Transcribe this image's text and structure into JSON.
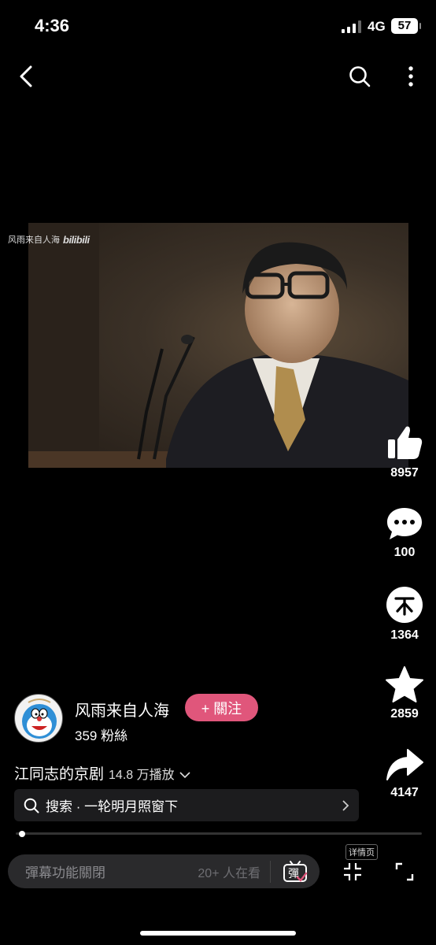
{
  "status_bar": {
    "time": "4:36",
    "network": "4G",
    "battery": "57"
  },
  "video": {
    "watermark_text": "风雨来自人海",
    "watermark_logo": "bilibili"
  },
  "actions": {
    "like_count": "8957",
    "comment_count": "100",
    "coin_count": "1364",
    "favorite_count": "2859",
    "share_count": "4147"
  },
  "author": {
    "name": "风雨来自人海",
    "follow_label": "+ 關注",
    "fans": "359 粉絲"
  },
  "video_info": {
    "title": "江同志的京剧",
    "views": "14.8 万播放"
  },
  "search": {
    "text": "搜索 · 一轮明月照窗下"
  },
  "progress": {
    "fraction": 0.008
  },
  "danmaku": {
    "placeholder": "彈幕功能關閉",
    "watching": "20+ 人在看",
    "toggle_label": "彈"
  },
  "controls": {
    "detail_label": "详情页"
  },
  "colors": {
    "accent": "#e0567b",
    "background": "#000000"
  }
}
